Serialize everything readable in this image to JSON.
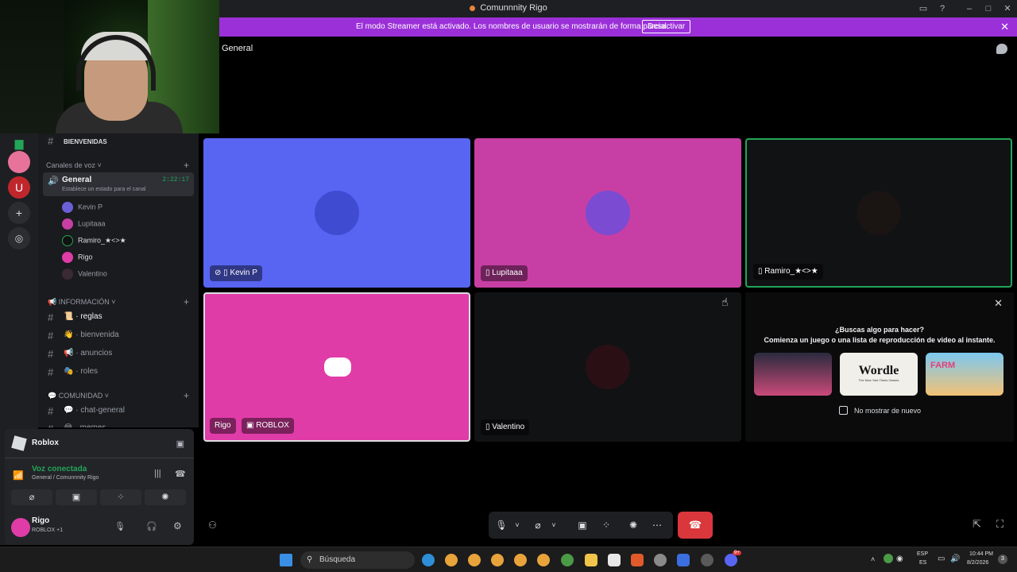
{
  "window": {
    "title": "Comunnnity Rigo"
  },
  "banner": {
    "message": "El modo Streamer está activado. Los nombres de usuario se mostrarán de forma parcial.",
    "button": "Desactivar"
  },
  "channel": {
    "title": "General"
  },
  "sidebar": {
    "top_channel": "BIENVENIDAS",
    "voice_category": "Canales de voz",
    "voice_channel": {
      "name": "General",
      "timer": "2:22:17",
      "status": "Establece un estado para el canal"
    },
    "voice_users": [
      "Kevin P",
      "Lupitaaa",
      "Ramiro_★<>★",
      "Rigo",
      "Valentino"
    ],
    "info_category": "INFORMACIÓN",
    "info_channels": [
      "reglas",
      "bienvenida",
      "anuncios",
      "roles"
    ],
    "community_category": "COMUNIDAD",
    "community_channels": [
      "chat-general",
      "memes"
    ]
  },
  "activity_status": {
    "game": "Roblox"
  },
  "voice_status": {
    "label": "Voz conectada",
    "location": "General / Comunnnity Rigo"
  },
  "user": {
    "name": "Rigo",
    "status": "ROBLOX +1"
  },
  "tiles": [
    {
      "name": "Kevin P",
      "color": "#5865f2"
    },
    {
      "name": "Lupitaaa",
      "color": "#c73fa4"
    },
    {
      "name": "Ramiro_★<>★",
      "color": "#111214"
    },
    {
      "name": "Rigo",
      "badge": "ROBLOX",
      "color": "#e03ca8"
    },
    {
      "name": "Valentino",
      "color": "#111214"
    }
  ],
  "activity_panel": {
    "question": "¿Buscas algo para hacer?",
    "subtitle": "Comienza un juego o una lista de reproducción de video al instante.",
    "cards": [
      "",
      "Wordle",
      "FARM"
    ],
    "wordle_sub": "The New York Times Games",
    "checkbox": "No mostrar de nuevo"
  },
  "taskbar": {
    "search": "Búsqueda",
    "lang": "ESP",
    "lang2": "ES",
    "time": "10:44 PM",
    "date": "8/2/2026",
    "discord_badge": "9+",
    "notif": "3"
  }
}
